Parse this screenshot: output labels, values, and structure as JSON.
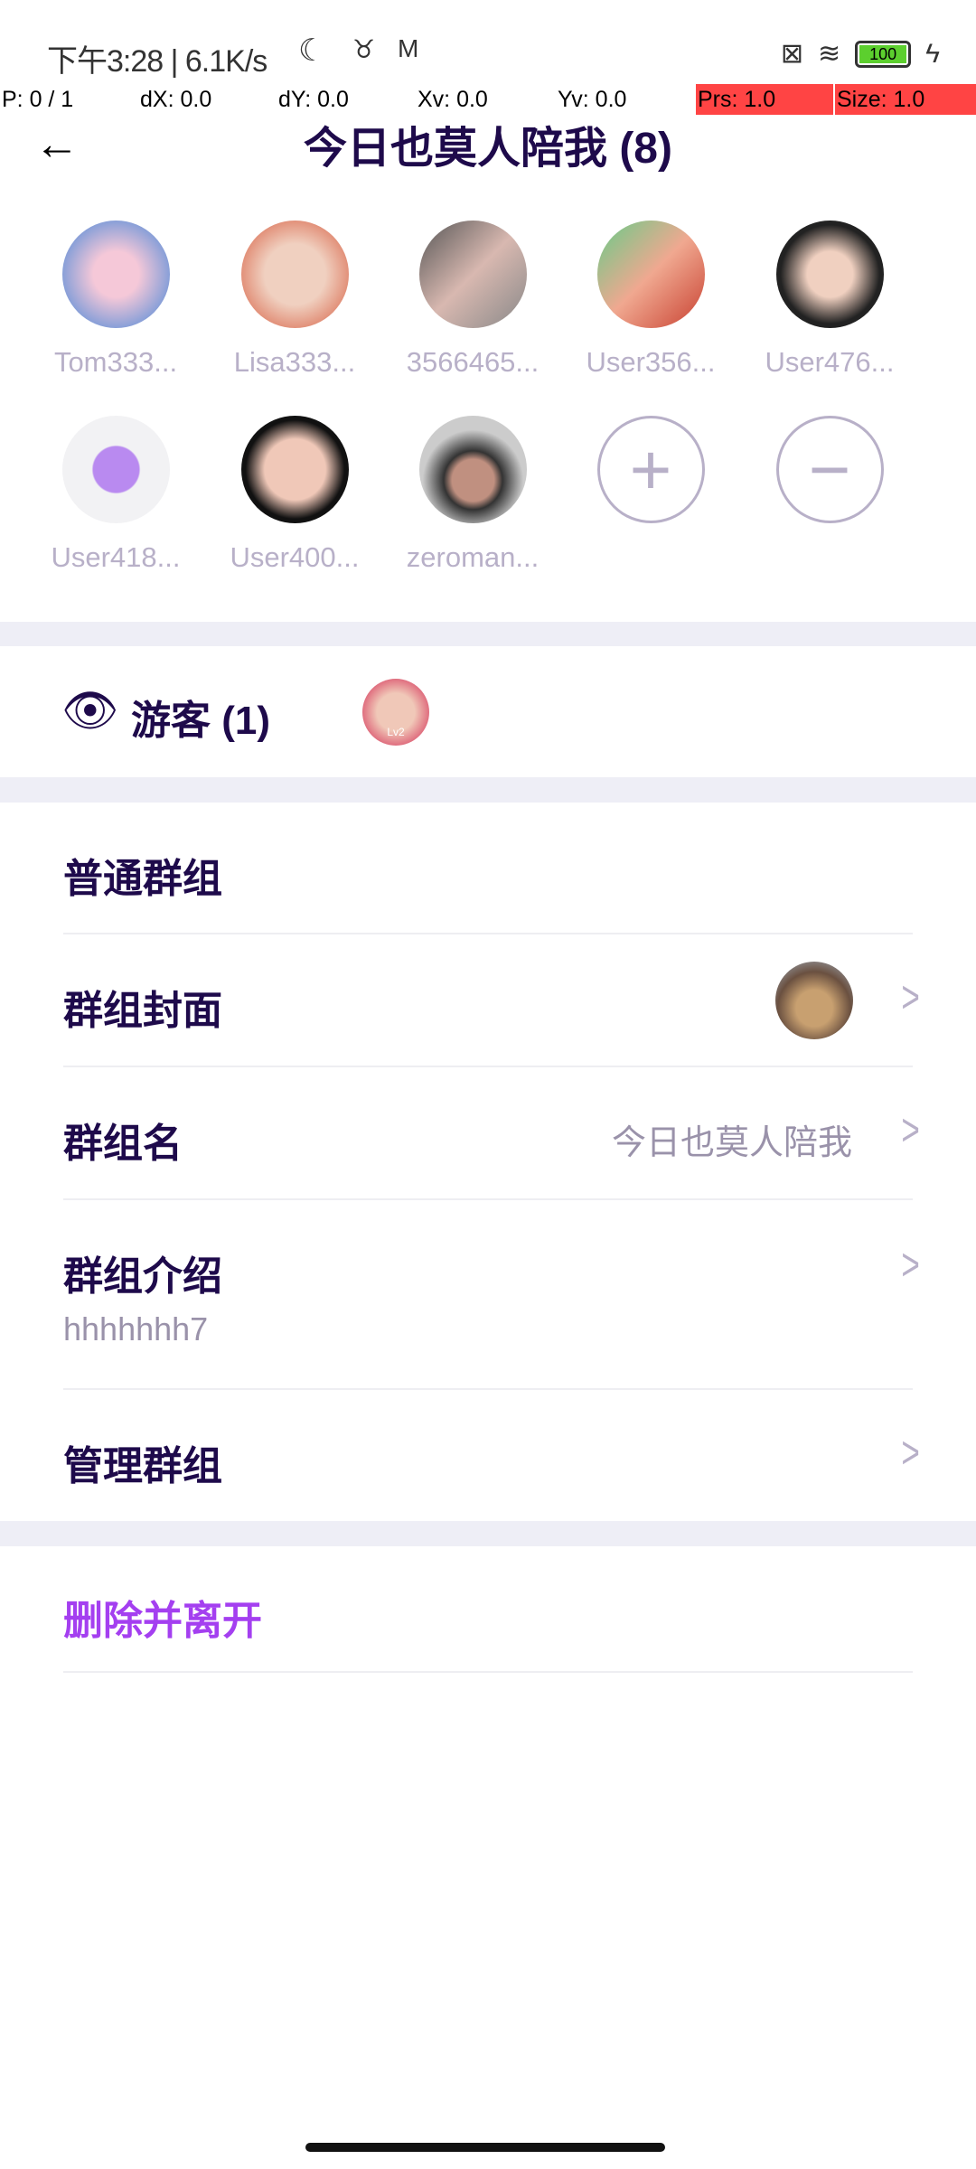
{
  "status_bar": {
    "time": "下午3:28 | 6.1K/s",
    "battery": "100",
    "icons": [
      "moon-icon",
      "notification-icon",
      "mail-icon",
      "sim-x-icon",
      "wifi-icon",
      "battery-icon",
      "charging-icon"
    ]
  },
  "debug_bar": {
    "p": "P: 0 / 1",
    "dx": "dX: 0.0",
    "dy": "dY: 0.0",
    "xv": "Xv: 0.0",
    "yv": "Yv: 0.0",
    "prs": "Prs: 1.0",
    "size": "Size: 1.0"
  },
  "header": {
    "title": "今日也莫人陪我 (8)"
  },
  "members": [
    {
      "name": "Tom333..."
    },
    {
      "name": "Lisa333..."
    },
    {
      "name": "3566465..."
    },
    {
      "name": "User356..."
    },
    {
      "name": "User476..."
    },
    {
      "name": "User418..."
    },
    {
      "name": "User400..."
    },
    {
      "name": "zeroman..."
    }
  ],
  "visitors": {
    "label": "游客 (1)",
    "badge": "Lv2"
  },
  "settings": {
    "section": "普通群组",
    "cover": "群组封面",
    "name_label": "群组名",
    "name_value": "今日也莫人陪我",
    "intro_label": "群组介绍",
    "intro_value": "hhhhhhh7",
    "manage": "管理群组",
    "delete": "删除并离开"
  },
  "colors": {
    "title": "#1e0a4b",
    "muted": "#b8b0c8",
    "danger": "#a43ff0",
    "band": "#eeeef6"
  }
}
